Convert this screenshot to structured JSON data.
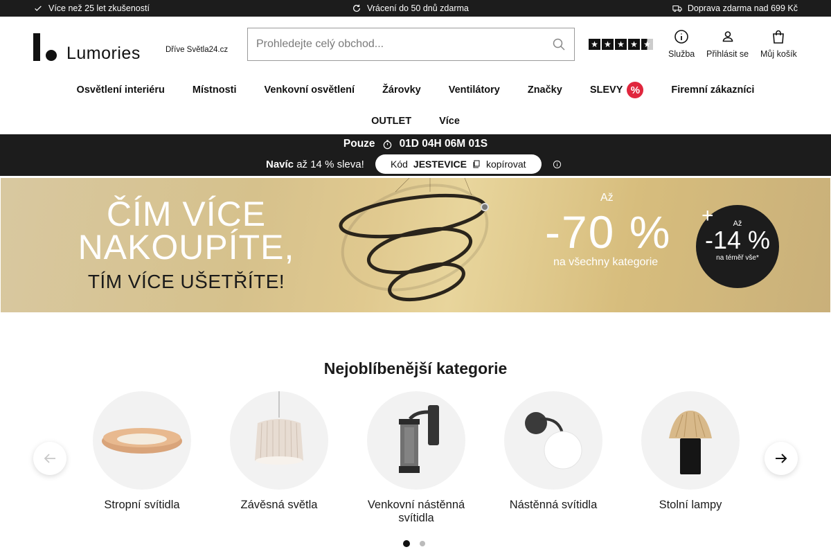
{
  "topbar": {
    "experience": "Více než 25 let zkušeností",
    "returns": "Vrácení do 50 dnů zdarma",
    "shipping": "Doprava zdarma nad 699 Kč"
  },
  "header": {
    "logo_text": "Lumories",
    "formerly": "Dříve Světla24.cz",
    "search_placeholder": "Prohledejte celý obchod...",
    "rating_stars": 4.5,
    "service_label": "Služba",
    "login_label": "Přihlásit se",
    "cart_label": "Můj košík"
  },
  "nav": {
    "row1": [
      "Osvětlení interiéru",
      "Místnosti",
      "Venkovní osvětlení",
      "Žárovky",
      "Ventilátory",
      "Značky",
      "SLEVY",
      "Firemní zákazníci"
    ],
    "row2": [
      "OUTLET",
      "Více"
    ],
    "sale_badge": "%"
  },
  "promo": {
    "only": "Pouze",
    "countdown": "01D 04H 06M 01S",
    "extra_bold": "Navíc",
    "extra_text": "až 14 % sleva!",
    "code_label": "Kód",
    "code": "JESTEVICE",
    "copy_label": "kopírovat"
  },
  "banner": {
    "line1": "ČÍM VÍCE",
    "line2": "NAKOUPÍTE,",
    "line3": "TÍM VÍCE UŠETŘÍTE!",
    "upto": "Až",
    "discount": "-70 %",
    "discount_sub": "na všechny kategorie",
    "plus": "+",
    "badge_top": "Až",
    "badge_discount": "-14 %",
    "badge_sub": "na téměř vše*"
  },
  "categories": {
    "title": "Nejoblíbenější kategorie",
    "items": [
      {
        "label": "Stropní svítidla"
      },
      {
        "label": "Závěsná světla"
      },
      {
        "label": "Venkovní nástěnná svítidla"
      },
      {
        "label": "Nástěnná svítidla"
      },
      {
        "label": "Stolní lampy"
      }
    ],
    "active_page": 1,
    "page_count": 2
  },
  "colors": {
    "dark": "#1c1c1c",
    "sale_red": "#e0263d",
    "banner_gold": "#e0c98f"
  }
}
